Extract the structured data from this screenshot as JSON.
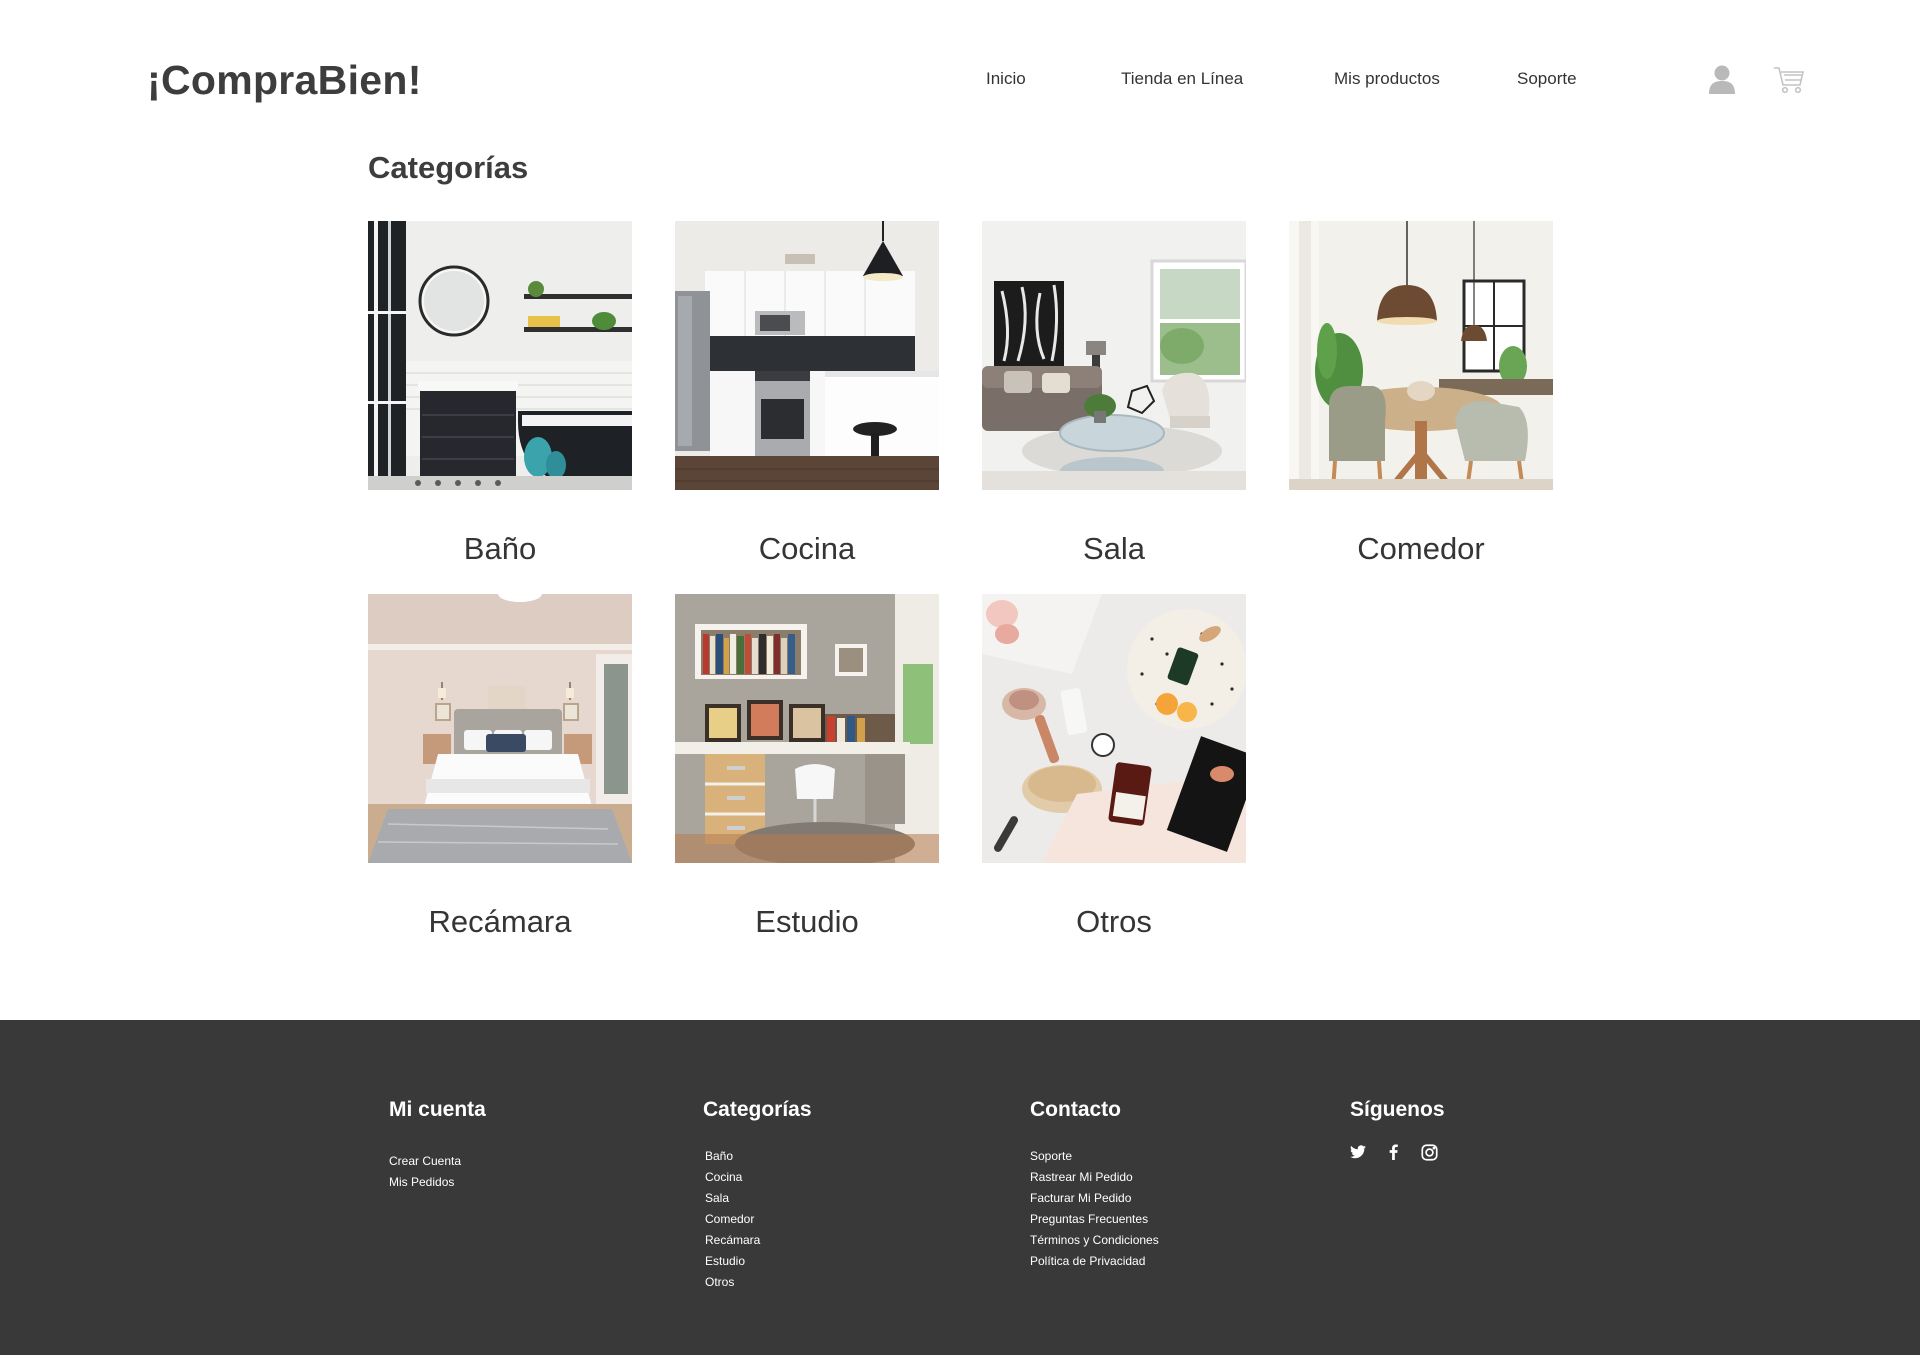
{
  "header": {
    "logo": "¡CompraBien!",
    "nav": [
      "Inicio",
      "Tienda en Línea",
      "Mis productos",
      "Soporte"
    ],
    "icons": [
      "user-icon",
      "cart-icon"
    ]
  },
  "main": {
    "title": "Categorías",
    "categories": [
      {
        "label": "Baño"
      },
      {
        "label": "Cocina"
      },
      {
        "label": "Sala"
      },
      {
        "label": "Comedor"
      },
      {
        "label": "Recámara"
      },
      {
        "label": "Estudio"
      },
      {
        "label": "Otros"
      }
    ]
  },
  "footer": {
    "background": "#393939",
    "account": {
      "title": "Mi cuenta",
      "links": [
        "Crear Cuenta",
        "Mis Pedidos"
      ]
    },
    "categories": {
      "title": "Categorías",
      "links": [
        "Baño",
        "Cocina",
        "Sala",
        "Comedor",
        "Recámara",
        "Estudio",
        "Otros"
      ]
    },
    "contact": {
      "title": "Contacto",
      "links": [
        "Soporte",
        "Rastrear Mi Pedido",
        "Facturar Mi Pedido",
        "Preguntas Frecuentes",
        "Términos y Condiciones",
        "Política de Privacidad"
      ]
    },
    "follow": {
      "title": "Síguenos",
      "icons": [
        "twitter-icon",
        "facebook-icon",
        "instagram-icon"
      ]
    }
  }
}
